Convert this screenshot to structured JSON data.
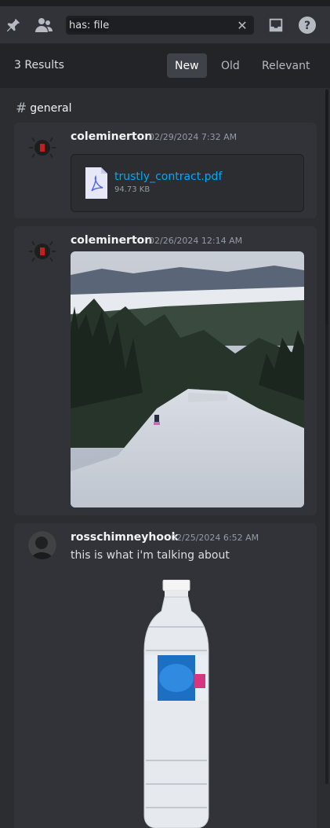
{
  "toolbar": {
    "search_value": "has: file",
    "icons": [
      "pin-icon",
      "members-icon",
      "clear-icon",
      "inbox-icon",
      "help-icon"
    ]
  },
  "results": {
    "count_label": "3 Results",
    "sort_options": [
      "New",
      "Old",
      "Relevant"
    ],
    "active_sort": "New"
  },
  "channel": {
    "name": "general"
  },
  "messages": [
    {
      "author": "coleminerton",
      "timestamp": "02/29/2024 7:32 AM",
      "attachment": {
        "type": "pdf",
        "file_name": "trustly_contract.pdf",
        "file_size": "94.73 KB"
      }
    },
    {
      "author": "coleminerton",
      "timestamp": "02/26/2024 12:14 AM",
      "attachment": {
        "type": "image"
      }
    },
    {
      "author": "rosschimneyhook",
      "timestamp": "02/25/2024 6:52 AM",
      "text": "this is what i'm talking about",
      "attachment": {
        "type": "image"
      }
    }
  ],
  "colors": {
    "accent": "#00a8fc",
    "background": "#2b2d31",
    "card": "#313338",
    "header": "#232428"
  }
}
